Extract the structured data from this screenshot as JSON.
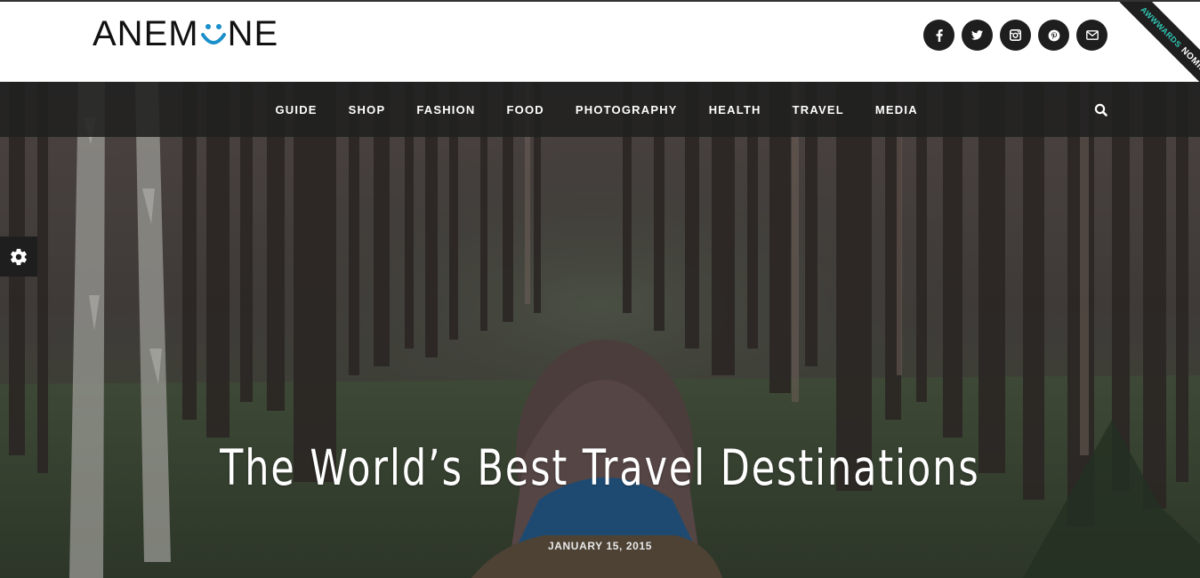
{
  "brand": {
    "logo_left": "ANEM",
    "logo_right": "NE"
  },
  "social": [
    {
      "name": "facebook-icon"
    },
    {
      "name": "twitter-icon"
    },
    {
      "name": "instagram-icon"
    },
    {
      "name": "pinterest-icon"
    },
    {
      "name": "email-icon"
    }
  ],
  "ribbon": {
    "badge": "AWWWARDS",
    "label": "NOMINEE"
  },
  "nav": {
    "items": [
      "GUIDE",
      "SHOP",
      "FASHION",
      "FOOD",
      "PHOTOGRAPHY",
      "HEALTH",
      "TRAVEL",
      "MEDIA"
    ],
    "search_icon": "search-icon"
  },
  "settings_icon": "gear-icon",
  "hero": {
    "title": "The World’s Best Travel Destinations",
    "date": "JANUARY 15, 2015"
  },
  "colors": {
    "accent": "#1a8fc9",
    "dark": "#1e1e1e",
    "ribbon_accent": "#30c7b5"
  }
}
